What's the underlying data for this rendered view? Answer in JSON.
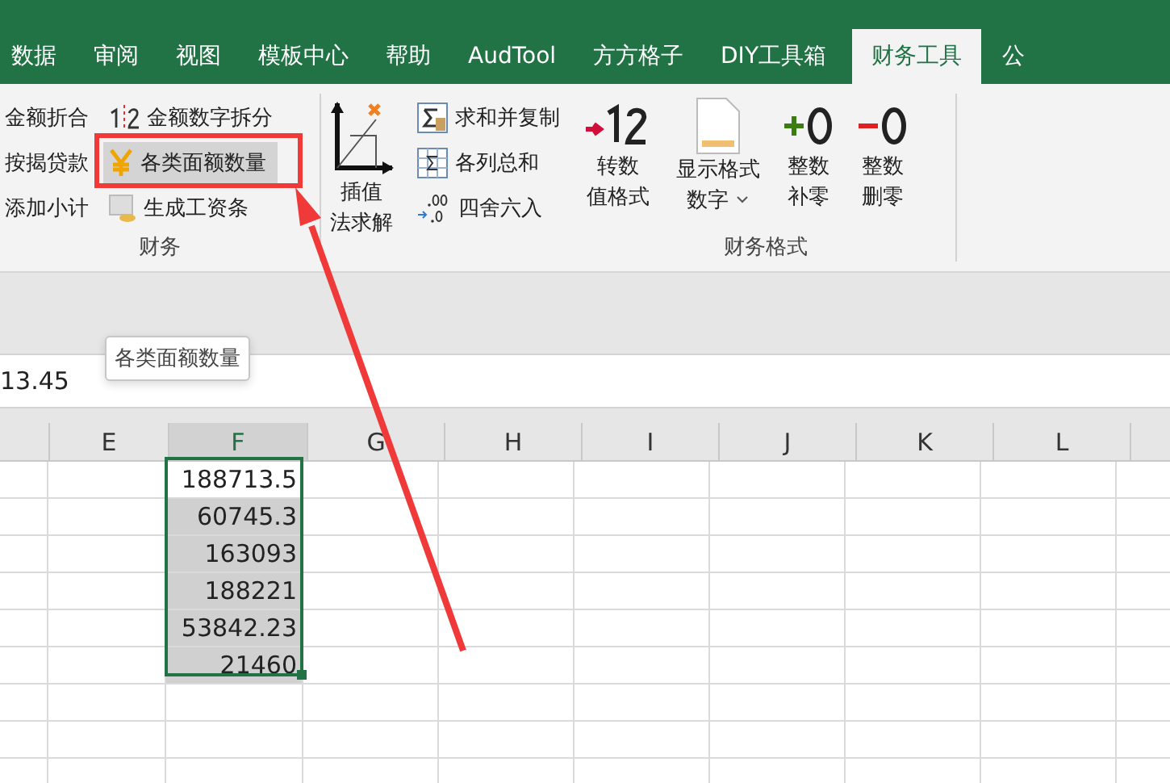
{
  "tabs": [
    {
      "label": "数据",
      "selected": false
    },
    {
      "label": "审阅",
      "selected": false
    },
    {
      "label": "视图",
      "selected": false
    },
    {
      "label": "模板中心",
      "selected": false
    },
    {
      "label": "帮助",
      "selected": false
    },
    {
      "label": "AudTool",
      "selected": false
    },
    {
      "label": "方方格子",
      "selected": false
    },
    {
      "label": "DIY工具箱",
      "selected": false
    },
    {
      "label": "财务工具",
      "selected": true
    },
    {
      "label": "公",
      "selected": false
    }
  ],
  "ribbon": {
    "groups": [
      {
        "label": "财务",
        "columns": [
          [
            {
              "label": "金额折合",
              "highlighted": false
            },
            {
              "label": "按揭贷款",
              "highlighted": false
            },
            {
              "label": "添加小计",
              "highlighted": false
            }
          ],
          [
            {
              "label": "金额数字拆分",
              "highlighted": false
            },
            {
              "label": "各类面额数量",
              "highlighted": true
            },
            {
              "label": "生成工资条",
              "highlighted": false
            }
          ]
        ]
      },
      {
        "large": [
          {
            "lines": [
              "插值",
              "法求解"
            ]
          }
        ],
        "columns": [
          [
            {
              "label": "求和并复制",
              "highlighted": false
            },
            {
              "label": "各列总和",
              "highlighted": false
            },
            {
              "label": "四舍六入",
              "highlighted": false
            }
          ]
        ]
      },
      {
        "label": "财务格式",
        "large": [
          {
            "lines": [
              "转数",
              "值格式"
            ]
          },
          {
            "lines": [
              "显示格式",
              "数字"
            ],
            "dropdown": true
          },
          {
            "lines": [
              "整数",
              "补零"
            ]
          },
          {
            "lines": [
              "整数",
              "删零"
            ]
          }
        ]
      }
    ]
  },
  "tooltip": "各类面额数量",
  "formula_bar": {
    "value": "13.45"
  },
  "sheet": {
    "columns": [
      {
        "label": "E",
        "selected": false
      },
      {
        "label": "F",
        "selected": true
      },
      {
        "label": "G",
        "selected": false
      },
      {
        "label": "H",
        "selected": false
      },
      {
        "label": "I",
        "selected": false
      },
      {
        "label": "J",
        "selected": false
      },
      {
        "label": "K",
        "selected": false
      },
      {
        "label": "L",
        "selected": false
      }
    ],
    "selected_column_cells": [
      {
        "value": "188713.5",
        "active": true
      },
      {
        "value": "60745.3",
        "active": false
      },
      {
        "value": "163093",
        "active": false
      },
      {
        "value": "188221",
        "active": false
      },
      {
        "value": "53842.23",
        "active": false
      },
      {
        "value": "21460",
        "active": false
      }
    ]
  }
}
